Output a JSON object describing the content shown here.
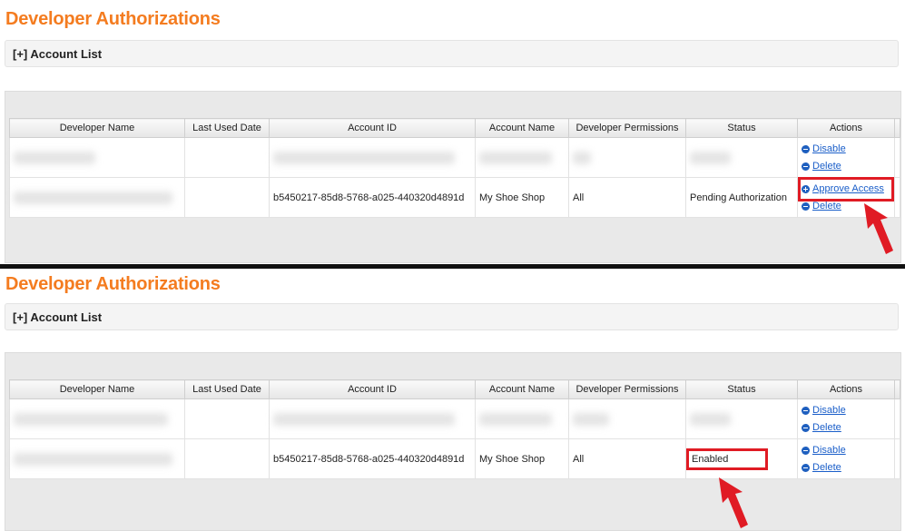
{
  "sections": [
    {
      "title": "Developer Authorizations",
      "account_list_label": "[+] Account List",
      "columns": [
        "Developer Name",
        "Last Used Date",
        "Account ID",
        "Account Name",
        "Developer Permissions",
        "Status",
        "Actions"
      ],
      "rows": [
        {
          "account_id": "",
          "account_name": "",
          "permissions": "",
          "status": "",
          "actions": [
            "Disable",
            "Delete"
          ]
        },
        {
          "account_id": "b5450217-85d8-5768-a025-440320d4891d",
          "account_name": "My Shoe Shop",
          "permissions": "All",
          "status": "Pending Authorization",
          "actions": [
            "Approve Access",
            "Delete"
          ]
        }
      ]
    },
    {
      "title": "Developer Authorizations",
      "account_list_label": "[+] Account List",
      "columns": [
        "Developer Name",
        "Last Used Date",
        "Account ID",
        "Account Name",
        "Developer Permissions",
        "Status",
        "Actions"
      ],
      "rows": [
        {
          "account_id": "",
          "account_name": "",
          "permissions": "",
          "status": "",
          "actions": [
            "Disable",
            "Delete"
          ]
        },
        {
          "account_id": "b5450217-85d8-5768-a025-440320d4891d",
          "account_name": "My Shoe Shop",
          "permissions": "All",
          "status": "Enabled",
          "actions": [
            "Disable",
            "Delete"
          ]
        }
      ]
    }
  ],
  "colors": {
    "title": "#f47c20",
    "link": "#1a5ec9",
    "highlight": "#e01b24"
  }
}
